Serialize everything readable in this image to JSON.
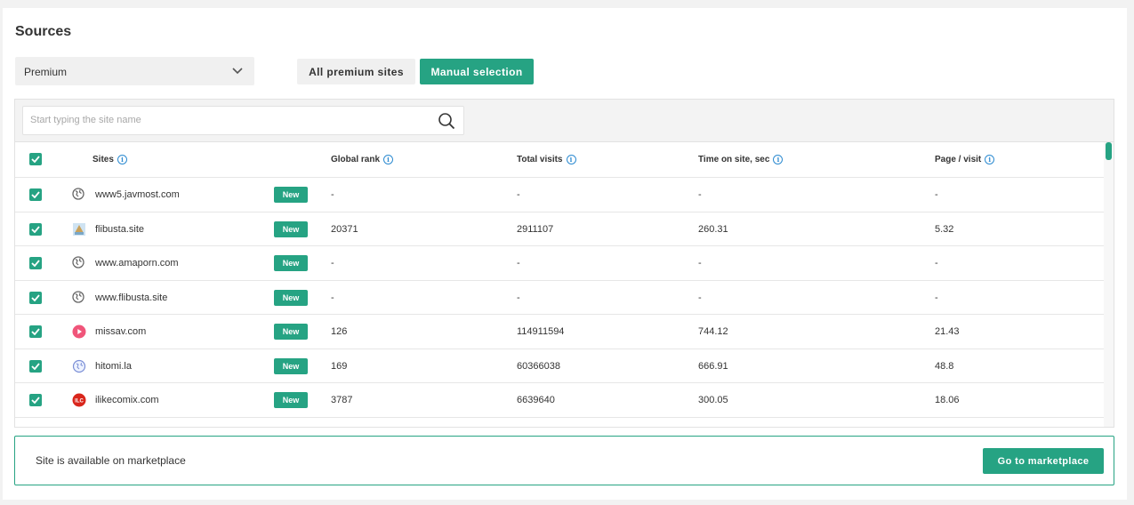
{
  "sources": {
    "title": "Sources",
    "dropdown_value": "Premium",
    "tabs": [
      {
        "label": "All premium sites",
        "active": false
      },
      {
        "label": "Manual selection",
        "active": true
      }
    ]
  },
  "search": {
    "placeholder": "Start typing the site name"
  },
  "table": {
    "headers": {
      "sites": "Sites",
      "global_rank": "Global rank",
      "total_visits": "Total visits",
      "time_on_site": "Time on site, sec",
      "page_visit": "Page / visit"
    },
    "rows": [
      {
        "site": "www5.javmost.com",
        "badge": "New",
        "rank": "-",
        "visits": "-",
        "time": "-",
        "page": "-",
        "icon": "globe-icon",
        "checked": true
      },
      {
        "site": "flibusta.site",
        "badge": "New",
        "rank": "20371",
        "visits": "2911107",
        "time": "260.31",
        "page": "5.32",
        "icon": "flibusta-favicon",
        "checked": true
      },
      {
        "site": "www.amaporn.com",
        "badge": "New",
        "rank": "-",
        "visits": "-",
        "time": "-",
        "page": "-",
        "icon": "globe-icon",
        "checked": true
      },
      {
        "site": "www.flibusta.site",
        "badge": "New",
        "rank": "-",
        "visits": "-",
        "time": "-",
        "page": "-",
        "icon": "globe-icon",
        "checked": true
      },
      {
        "site": "missav.com",
        "badge": "New",
        "rank": "126",
        "visits": "114911594",
        "time": "744.12",
        "page": "21.43",
        "icon": "play-favicon",
        "checked": true
      },
      {
        "site": "hitomi.la",
        "badge": "New",
        "rank": "169",
        "visits": "60366038",
        "time": "666.91",
        "page": "48.8",
        "icon": "globe-blue-favicon",
        "checked": true
      },
      {
        "site": "ilikecomix.com",
        "badge": "New",
        "rank": "3787",
        "visits": "6639640",
        "time": "300.05",
        "page": "18.06",
        "icon": "ilc-favicon",
        "checked": true
      }
    ]
  },
  "marketplace": {
    "message": "Site is available on marketplace",
    "button": "Go to marketplace"
  },
  "colors": {
    "accent": "#26a383",
    "info": "#2d8bd1"
  }
}
